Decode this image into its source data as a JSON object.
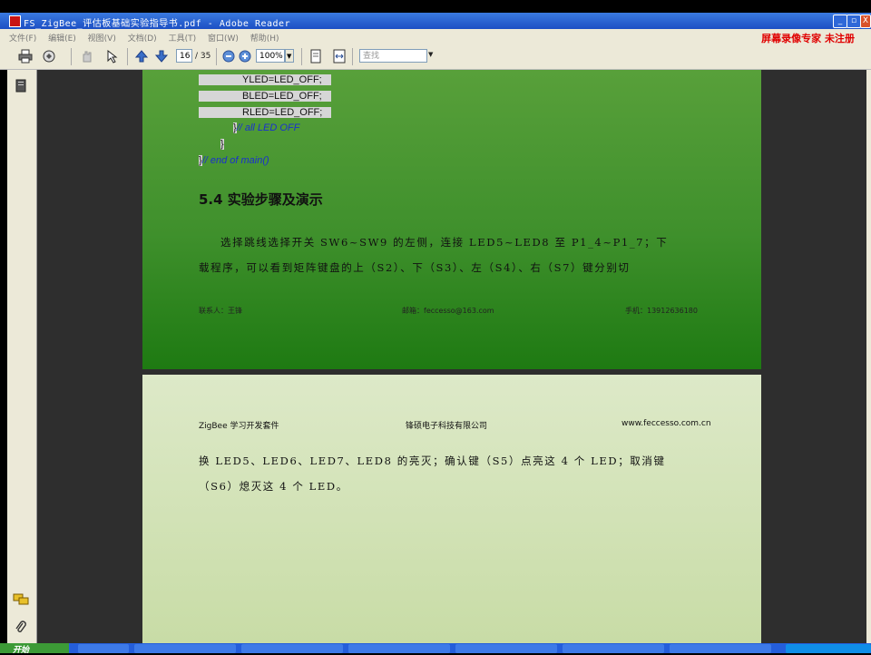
{
  "window": {
    "title": "FS_ZigBee_评估板基础实验指导书.pdf - Adobe Reader",
    "buttons": [
      "_",
      "▫",
      "X"
    ]
  },
  "menu": {
    "items": [
      "文件(F)",
      "编辑(E)",
      "视图(V)",
      "文档(D)",
      "工具(T)",
      "窗口(W)",
      "帮助(H)"
    ],
    "watermark": "屏幕录像专家 未注册"
  },
  "toolbar": {
    "page_current": "16",
    "page_total": "/ 35",
    "zoom": "100%",
    "search_placeholder": "查找"
  },
  "page1": {
    "code_lines": [
      "YLED=LED_OFF;",
      "BLED=LED_OFF;",
      "RLED=LED_OFF;"
    ],
    "close_brace_comment": "}",
    "comment_all_off": "//    all LED OFF",
    "inner_brace": "}",
    "end_brace": "}",
    "comment_end_main": "// end of main()",
    "section_heading": "5.4  实验步骤及演示",
    "para_line1": "选择跳线选择开关 SW6~SW9 的左侧，连接 LED5~LED8 至 P1_4~P1_7；下",
    "para_line2": "载程序，可以看到矩阵键盘的上（S2）、下（S3）、左（S4）、右（S7）键分别切",
    "footer_contact": "联系人：王锋",
    "footer_email": "邮箱：feccesso@163.com",
    "footer_phone": "手机：13912636180"
  },
  "page2": {
    "header_left": "ZigBee 学习开发套件",
    "header_center": "锋硕电子科技有限公司",
    "header_right": "www.feccesso.com.cn",
    "para_line1": "换 LED5、LED6、LED7、LED8 的亮灭；确认键（S5）点亮这 4 个 LED；取消键",
    "para_line2": "（S6）熄灭这 4 个 LED。"
  },
  "taskbar": {
    "start_label": "开始"
  }
}
